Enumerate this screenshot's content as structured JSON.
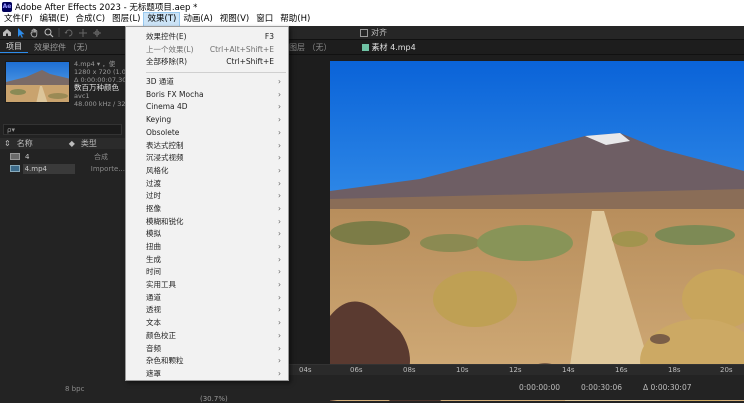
{
  "window": {
    "title": "Adobe After Effects 2023 - 无标题项目.aep *",
    "app_badge": "Ae"
  },
  "menubar": {
    "items": [
      "文件(F)",
      "编辑(E)",
      "合成(C)",
      "图层(L)",
      "效果(T)",
      "动画(A)",
      "视图(V)",
      "窗口",
      "帮助(H)"
    ],
    "active_index": 4
  },
  "toolbar": {
    "tools": [
      "home-icon",
      "selection-arrow-icon",
      "hand-icon",
      "zoom-icon",
      "rotate-icon",
      "pan-behind-icon",
      "move-icon",
      "rectangle-icon",
      "pen-icon"
    ],
    "align_label": "对齐"
  },
  "project_panel": {
    "tabs": [
      "项目",
      "效果控件 （无）"
    ],
    "footage": {
      "name": "4.mp4 ▾ ，使",
      "resolution": "1280 x 720 (1.00)",
      "duration": "Δ 0:00:00:07.30",
      "fps_label": "数百万种颜色",
      "codec": "avc1",
      "audio": "48.000 kHz / 32 bi"
    },
    "search_placeholder": "ρ▾",
    "columns": {
      "name": "名称",
      "type": "类型"
    },
    "rows": [
      {
        "name": "4",
        "type": "合成"
      },
      {
        "name": "4.mp4",
        "type": "Importe..."
      }
    ],
    "bpc_label": "8 bpc"
  },
  "effect_menu": {
    "top_items": [
      {
        "label": "效果控件(E)",
        "shortcut": "F3",
        "disabled": false
      },
      {
        "label": "上一个效果(L)",
        "shortcut": "Ctrl+Alt+Shift+E",
        "disabled": true
      },
      {
        "label": "全部移除(R)",
        "shortcut": "Ctrl+Shift+E",
        "disabled": false
      }
    ],
    "sub_items": [
      "3D 通道",
      "Boris FX Mocha",
      "Cinema 4D",
      "Keying",
      "Obsolete",
      "表达式控制",
      "沉浸式视频",
      "风格化",
      "过渡",
      "过时",
      "抠像",
      "模糊和锐化",
      "模拟",
      "扭曲",
      "生成",
      "时间",
      "实用工具",
      "通道",
      "透视",
      "文本",
      "颜色校正",
      "音频",
      "杂色和颗粒",
      "遮罩"
    ]
  },
  "viewer": {
    "comp_tab": "图层 （无）",
    "footage_tab": "素材 4.mp4",
    "footage_tab_color": "#6fc2a4"
  },
  "timeline": {
    "ticks": [
      "04s",
      "06s",
      "08s",
      "10s",
      "12s",
      "14s",
      "16s",
      "18s",
      "20s"
    ],
    "start_time": "0:00:00:00",
    "end_time": "0:00:30:06",
    "duration": "Δ 0:00:30:07",
    "zoom": "(30.7%)"
  },
  "colors": {
    "accent": "#2d8ceb",
    "menu_bg": "#f2f2f2",
    "panel_bg": "#232323"
  }
}
